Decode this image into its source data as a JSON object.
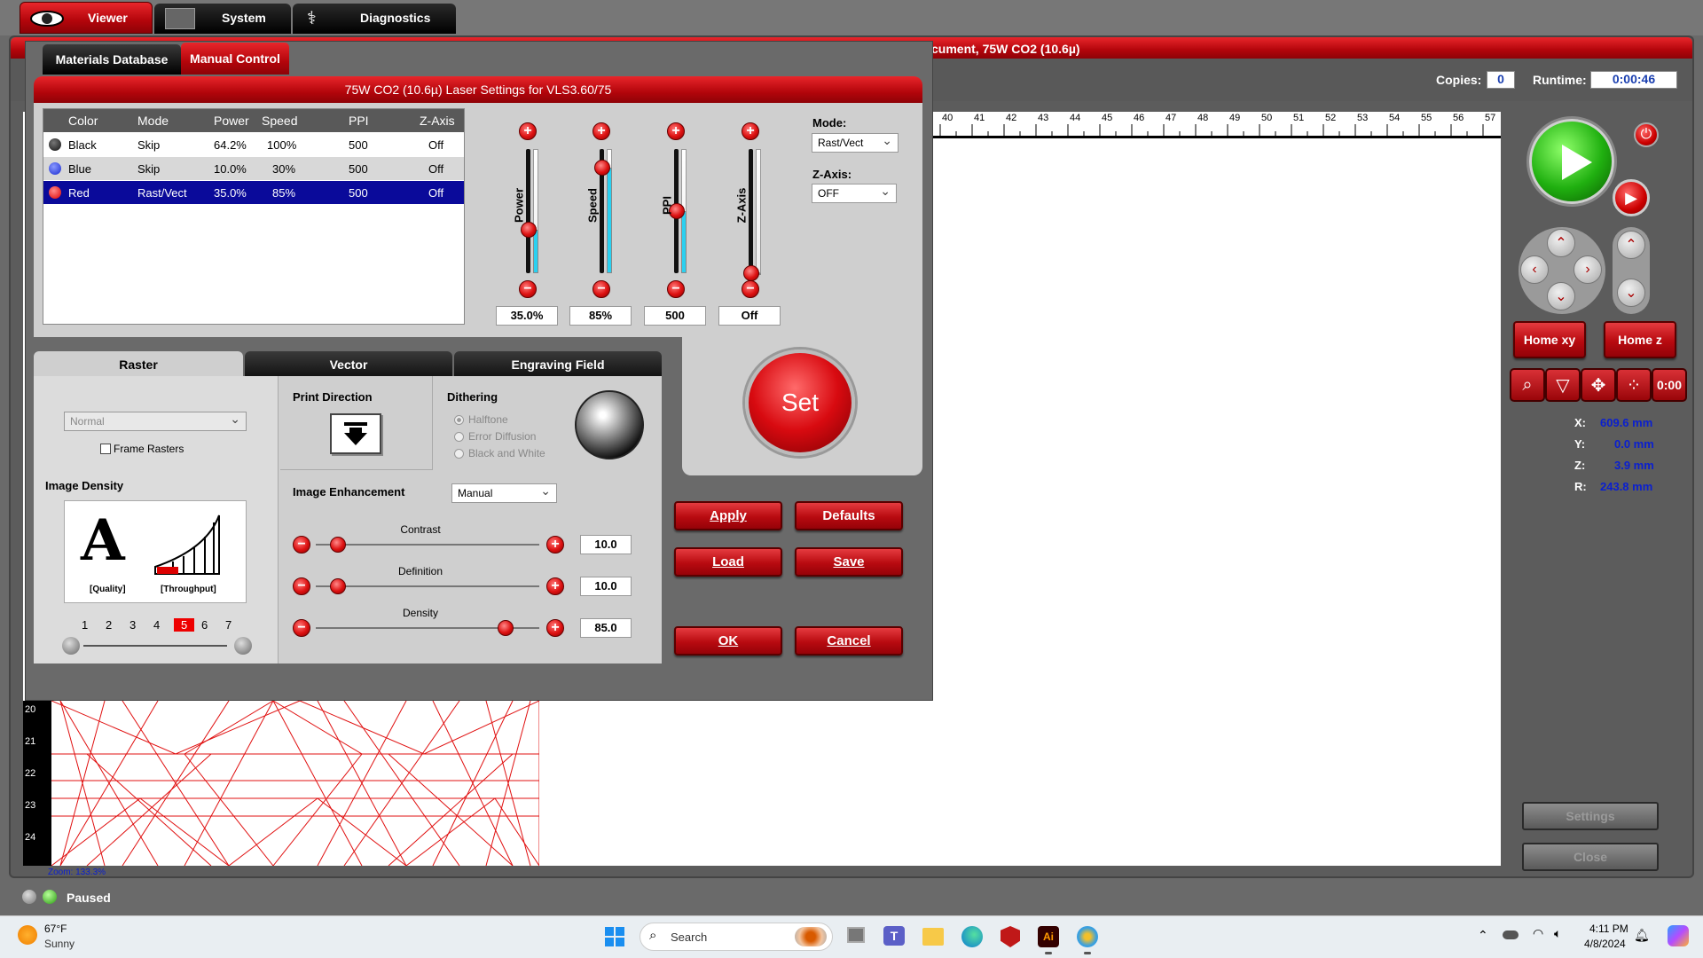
{
  "top_tabs": [
    {
      "label": "Viewer",
      "icon": "eye-icon"
    },
    {
      "label": "System",
      "icon": "waveform-icon"
    },
    {
      "label": "Diagnostics",
      "icon": "stethoscope-icon"
    }
  ],
  "doc_title_tail": "cument, 75W CO2 (10.6µ)",
  "copies": {
    "label": "Copies:",
    "value": "0"
  },
  "runtime": {
    "label": "Runtime:",
    "value": "0:00:46"
  },
  "ruler_h": [
    "40",
    "41",
    "42",
    "43",
    "44",
    "45",
    "46",
    "47",
    "48",
    "49",
    "50",
    "51",
    "52",
    "53",
    "54",
    "55",
    "56",
    "57"
  ],
  "ruler_v": [
    "20",
    "21",
    "22",
    "23",
    "24"
  ],
  "zoom": "Zoom: 133.3%",
  "status": "Paused",
  "dialog": {
    "tabs": [
      "Materials Database",
      "Manual Control"
    ],
    "title": "75W CO2 (10.6µ) Laser Settings for VLS3.60/75",
    "table": {
      "headers": [
        "Color",
        "Mode",
        "Power",
        "Speed",
        "PPI",
        "Z-Axis"
      ],
      "rows": [
        {
          "color": "Black",
          "swatch": "#222222",
          "mode": "Skip",
          "power": "64.2%",
          "speed": "100%",
          "ppi": "500",
          "z": "Off"
        },
        {
          "color": "Blue",
          "swatch": "#2b3de0",
          "mode": "Skip",
          "power": "10.0%",
          "speed": "30%",
          "ppi": "500",
          "z": "Off"
        },
        {
          "color": "Red",
          "swatch": "#e01010",
          "mode": "Rast/Vect",
          "power": "35.0%",
          "speed": "85%",
          "ppi": "500",
          "z": "Off"
        }
      ]
    },
    "sliders": [
      {
        "label": "Power",
        "value": "35.0%",
        "level": 0.35
      },
      {
        "label": "Speed",
        "value": "85%",
        "level": 0.85
      },
      {
        "label": "PPI",
        "value": "500",
        "level": 0.5
      },
      {
        "label": "Z-Axis",
        "value": "Off",
        "level": 0.0
      }
    ],
    "mode_label": "Mode:",
    "mode_value": "Rast/Vect",
    "zaxis_label": "Z-Axis:",
    "zaxis_value": "OFF",
    "set_label": "Set",
    "sub_tabs": [
      "Raster",
      "Vector",
      "Engraving Field"
    ],
    "raster": {
      "quality_select": "Normal",
      "frame_rasters": "Frame Rasters",
      "image_density": "Image Density",
      "quality_caption": "[Quality]",
      "throughput_caption": "[Throughput]",
      "density_steps": [
        "1",
        "2",
        "3",
        "4",
        "5",
        "6",
        "7"
      ],
      "density_selected": "5",
      "print_direction": "Print Direction",
      "dithering": "Dithering",
      "dither_options": [
        "Halftone",
        "Error Diffusion",
        "Black and White"
      ],
      "image_enhancement": "Image Enhancement",
      "enhancement_value": "Manual",
      "contrast_label": "Contrast",
      "contrast_value": "10.0",
      "contrast_level": 0.1,
      "definition_label": "Definition",
      "definition_value": "10.0",
      "definition_level": 0.1,
      "density_label": "Density",
      "density_value": "85.0",
      "density_level": 0.85
    },
    "buttons": {
      "apply": "Apply",
      "defaults": "Defaults",
      "load": "Load",
      "save": "Save",
      "ok": "OK",
      "cancel": "Cancel"
    }
  },
  "right_panel": {
    "home_xy": "Home xy",
    "home_z": "Home z",
    "coords": [
      {
        "label": "X:",
        "value": "609.6 mm"
      },
      {
        "label": "Y:",
        "value": "0.0 mm"
      },
      {
        "label": "Z:",
        "value": "3.9 mm"
      },
      {
        "label": "R:",
        "value": "243.8 mm"
      }
    ],
    "settings": "Settings",
    "close": "Close"
  },
  "taskbar": {
    "weather_temp": "67°F",
    "weather_desc": "Sunny",
    "search": "Search",
    "time": "4:11 PM",
    "date": "4/8/2024"
  }
}
